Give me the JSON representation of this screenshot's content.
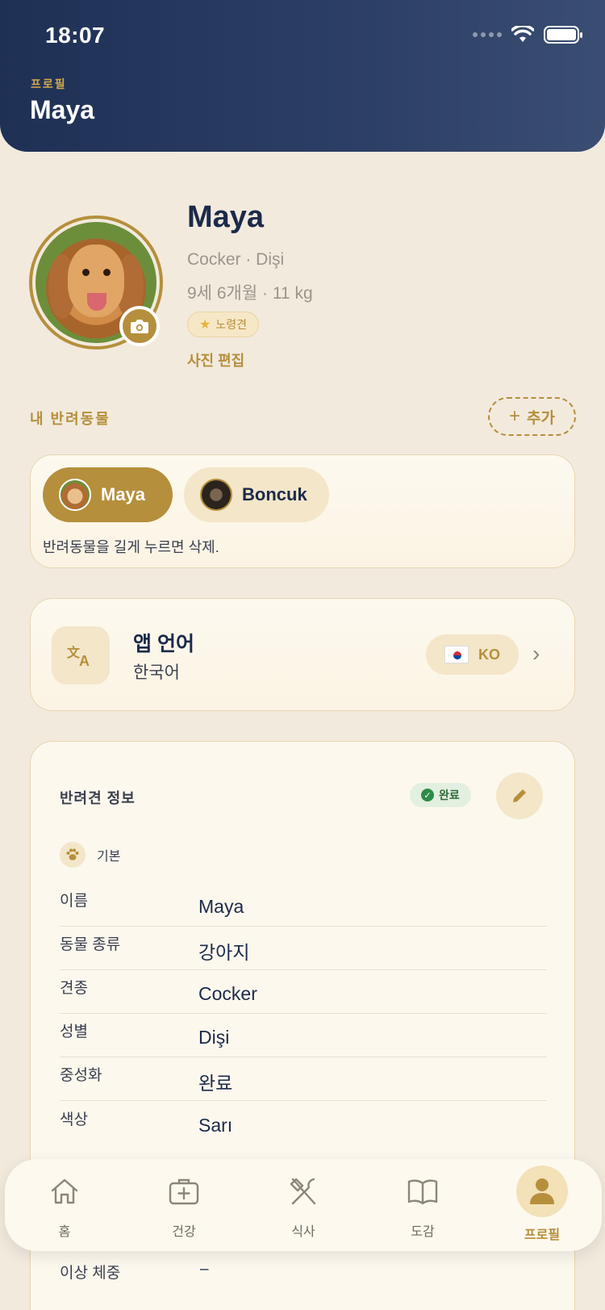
{
  "status": {
    "time": "18:07"
  },
  "header": {
    "subtitle": "프로필",
    "title": "Maya"
  },
  "profile": {
    "name": "Maya",
    "breed_sex": "Cocker · Dişi",
    "age_weight": "9세 6개월 · 11 kg",
    "badge": "노령견",
    "edit_photo": "사진 편집"
  },
  "pets": {
    "section_label": "내 반려동물",
    "add_label": "추가",
    "items": [
      {
        "name": "Maya",
        "active": true
      },
      {
        "name": "Boncuk",
        "active": false
      }
    ],
    "hint": "반려동물을 길게 누르면 삭제."
  },
  "language": {
    "title": "앱 언어",
    "value": "한국어",
    "code": "KO"
  },
  "info": {
    "title": "반려견 정보",
    "status": "완료",
    "group_label": "기본",
    "rows": [
      {
        "key": "이름",
        "value": "Maya"
      },
      {
        "key": "동물 종류",
        "value": "강아지"
      },
      {
        "key": "견종",
        "value": "Cocker"
      },
      {
        "key": "성별",
        "value": "Dişi"
      },
      {
        "key": "중성화",
        "value": "완료"
      },
      {
        "key": "색상",
        "value": "Sarı"
      }
    ],
    "ideal_weight": {
      "key": "이상 체중",
      "value": "–"
    }
  },
  "tabbar": {
    "items": [
      {
        "label": "홈",
        "icon": "home-icon"
      },
      {
        "label": "건강",
        "icon": "medical-kit-icon"
      },
      {
        "label": "식사",
        "icon": "fork-knife-icon"
      },
      {
        "label": "도감",
        "icon": "book-icon"
      },
      {
        "label": "프로필",
        "icon": "person-icon"
      }
    ],
    "active_index": 4
  },
  "colors": {
    "accent": "#b58f3c",
    "header_bg": "#1f3055",
    "background": "#f2eadd",
    "success": "#2e8b47"
  }
}
